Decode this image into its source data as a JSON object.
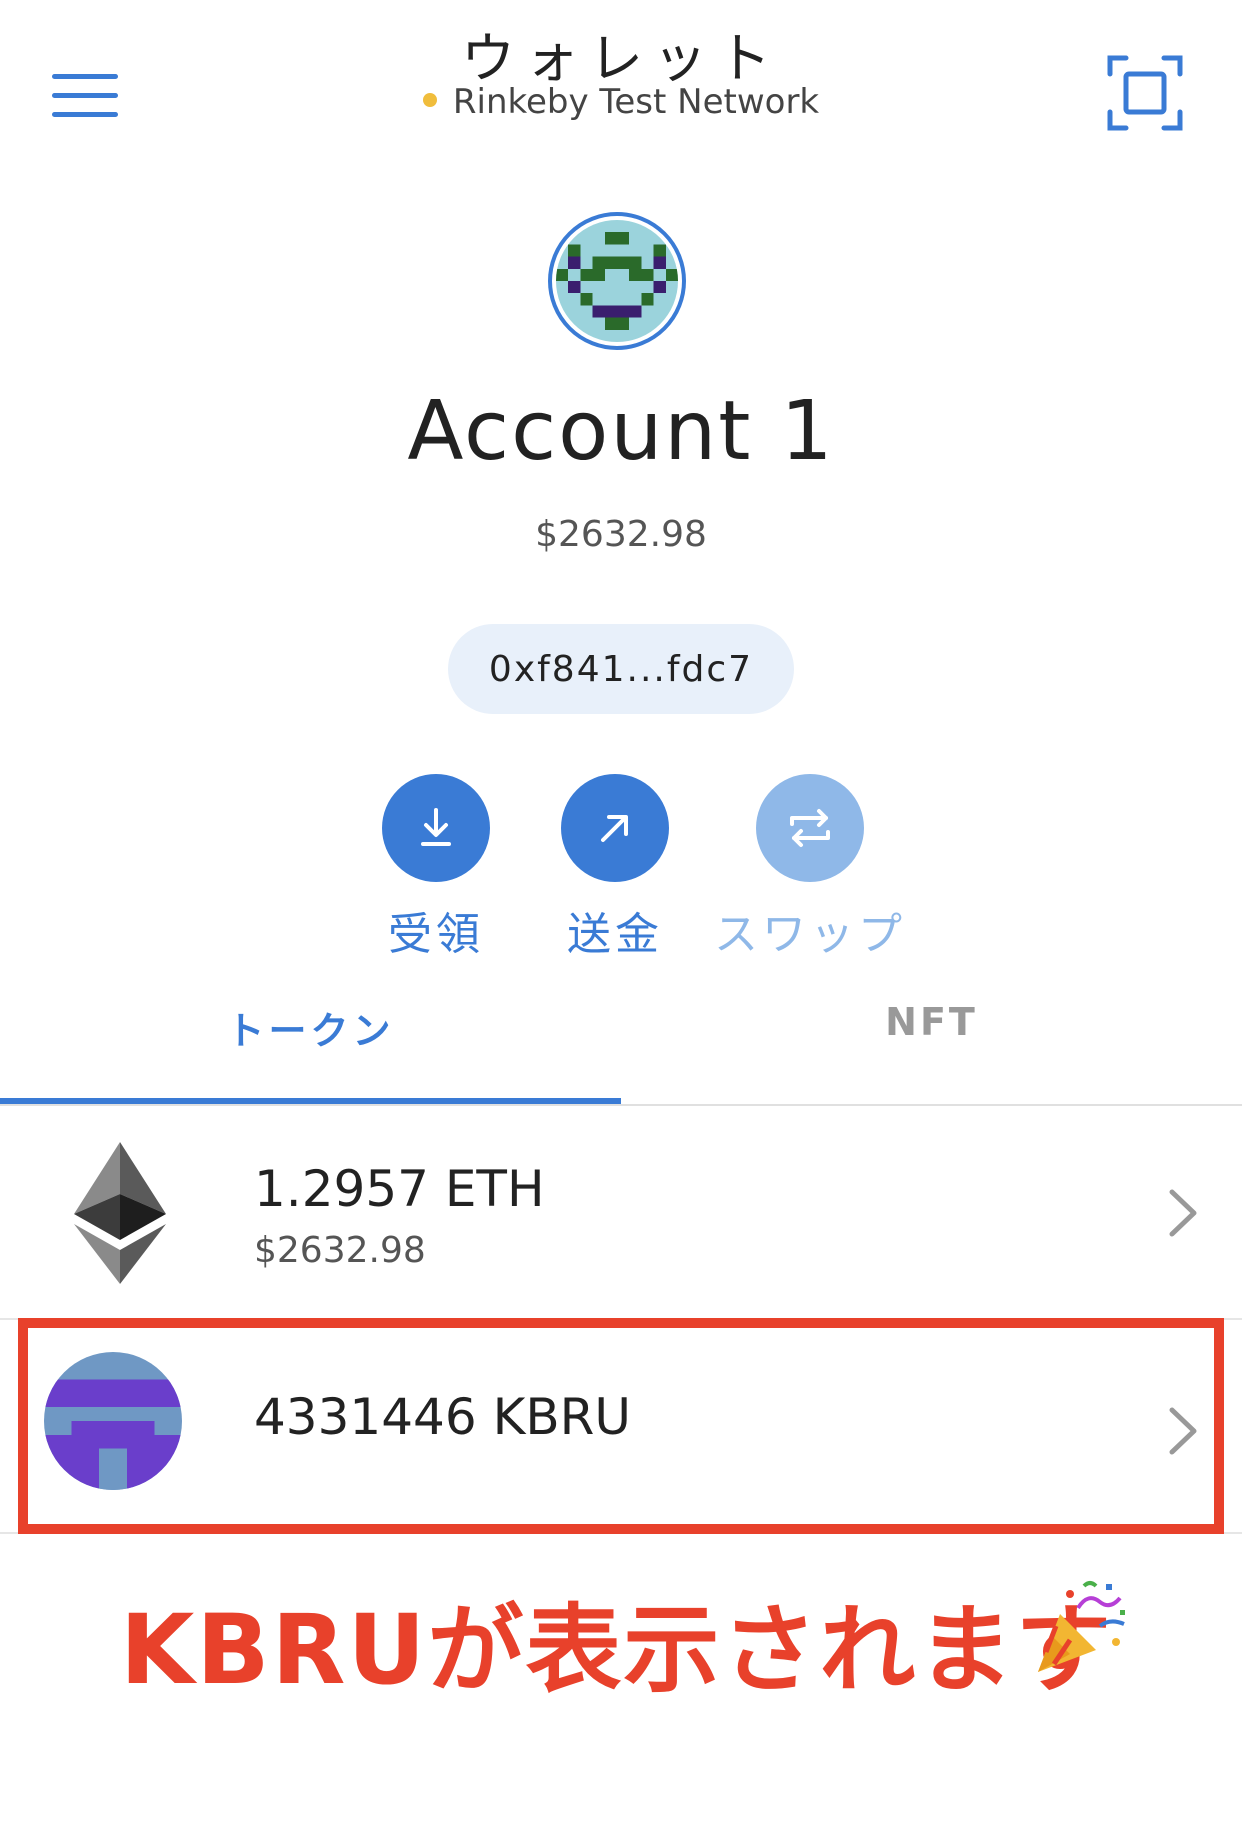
{
  "header": {
    "title": "ウォレット",
    "network": "Rinkeby Test Network",
    "network_dot_color": "#f0bd3c",
    "menu_icon": "hamburger-menu-icon",
    "scan_icon": "qr-scan-icon"
  },
  "account": {
    "name": "Account 1",
    "balance": "$2632.98",
    "address": "0xf841...fdc7"
  },
  "actions": [
    {
      "label": "受領",
      "icon": "download-icon",
      "enabled": true
    },
    {
      "label": "送金",
      "icon": "arrow-up-right-icon",
      "enabled": true
    },
    {
      "label": "スワップ",
      "icon": "swap-icon",
      "enabled": false
    }
  ],
  "tabs": [
    {
      "label": "トークン",
      "active": true
    },
    {
      "label": "NFT",
      "active": false
    }
  ],
  "tokens": [
    {
      "amount": "1.2957 ETH",
      "fiat": "$2632.98",
      "icon": "ethereum-icon"
    },
    {
      "amount": "4331446 KBRU",
      "fiat": "",
      "icon": "kbru-token-icon"
    }
  ],
  "annotation": {
    "caption": "KBRUが表示されます",
    "emoji": "party-popper-icon",
    "color": "#e8412b"
  },
  "colors": {
    "accent": "#3a7bd5",
    "accent_disabled": "#8fb8e8"
  }
}
